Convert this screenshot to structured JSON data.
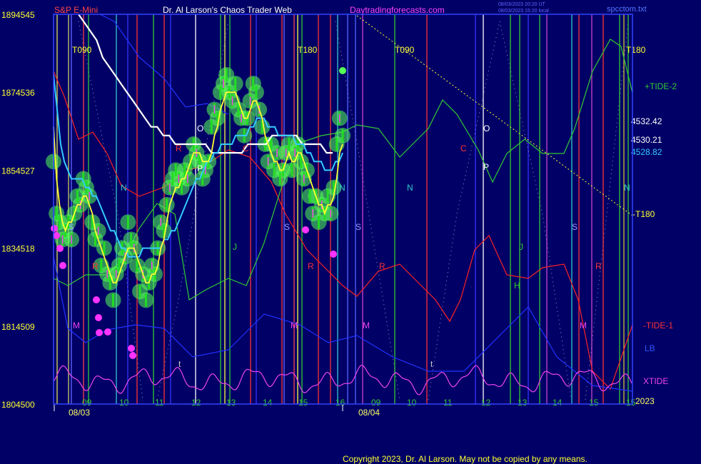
{
  "header": {
    "left_title": "S&P E-Mini",
    "center_title": "Dr. Al Larson's Chaos Trader Web",
    "site": "Daytradingforecasts.com",
    "timestamp_1": "08/03/2023 20:20 UT",
    "timestamp_2": "08/03/2023 15:20 local",
    "file_name": "spcctom.txt"
  },
  "footer": {
    "copyright": "Copyright 2023, Dr. Al Larson. May not be copied by any means."
  },
  "colors": {
    "background": "#000066",
    "price_bars": "#22dd22",
    "glow": "#55ff55",
    "yellow_avg": "#ffff33",
    "cyan_avg": "#33ccff",
    "white_avg": "#ffffff",
    "magenta": "#ff33ff",
    "tide2": "#33cc33",
    "tide1": "#ff2222",
    "lb": "#2233ff",
    "xtide": "#ee44ee"
  },
  "chart_data": {
    "type": "line",
    "title": "S&P E-Mini",
    "y_ticks": [
      {
        "left": "189",
        "right": "4545",
        "value": 4545
      },
      {
        "left": "187",
        "right": "4536",
        "value": 4536
      },
      {
        "left": "185",
        "right": "4527",
        "value": 4527
      },
      {
        "left": "183",
        "right": "4518",
        "value": 4518
      },
      {
        "left": "181",
        "right": "4509",
        "value": 4509
      },
      {
        "left": "180",
        "right": "4500",
        "value": 4500
      }
    ],
    "ylim": [
      4500,
      4545
    ],
    "x_hour_labels": [
      "09",
      "10",
      "11",
      "12",
      "13",
      "14",
      "15",
      "16",
      "09",
      "10",
      "11",
      "12",
      "13",
      "14",
      "15",
      "15"
    ],
    "x_dates": [
      "08/03",
      "08/04"
    ],
    "year_label": "2023",
    "top_labels": [
      "T090",
      "T180",
      "T090",
      "T180"
    ],
    "line_letters": [
      "O",
      "P",
      "O",
      "P",
      "N",
      "N",
      "N",
      "N",
      "S",
      "S",
      "S",
      "S",
      "J",
      "J",
      "H",
      "R",
      "R",
      "R",
      "R",
      "R",
      "C",
      "C",
      "M",
      "M",
      "M",
      "M",
      "t",
      "t"
    ],
    "right_labels": {
      "tide2": "+TIDE-2",
      "price_1": "4532.42",
      "price_2": "4530.21",
      "price_3": "4528.82",
      "t180": "-T180",
      "tide1": "-TIDE-1",
      "lb": "LB",
      "xtide": "XTIDE"
    },
    "price": [
      4528,
      4522,
      4521,
      4519,
      4520,
      4521,
      4519,
      4522,
      4524,
      4523,
      4526,
      4525,
      4524,
      4521,
      4519,
      4520,
      4516,
      4518,
      4515,
      4514,
      4512,
      4515,
      4516,
      4518,
      4517,
      4521,
      4519,
      4518,
      4516,
      4513,
      4515,
      4512,
      4514,
      4516,
      4515,
      4518,
      4521,
      4520,
      4523,
      4525,
      4526,
      4527,
      4526,
      4525,
      4527,
      4526,
      4528,
      4530,
      4529,
      4528,
      4526,
      4527,
      4528,
      4532,
      4534,
      4533,
      4536,
      4537,
      4538,
      4536,
      4535,
      4537,
      4534,
      4533,
      4531,
      4533,
      4535,
      4537,
      4536,
      4534,
      4532,
      4530,
      4528,
      4530,
      4527,
      4529,
      4526,
      4527,
      4529,
      4530,
      4527,
      4529,
      4530,
      4528,
      4526,
      4527,
      4524,
      4522,
      4524,
      4521,
      4523,
      4522,
      4524,
      4522,
      4525,
      4530,
      4533,
      4531
    ],
    "yellow_avg": [
      4532,
      4526,
      4523,
      4521,
      4520,
      4521,
      4521,
      4522,
      4523,
      4523,
      4524,
      4524,
      4523,
      4522,
      4520,
      4519,
      4518,
      4517,
      4516,
      4515,
      4514,
      4514,
      4515,
      4516,
      4517,
      4518,
      4518,
      4518,
      4517,
      4516,
      4515,
      4514,
      4514,
      4515,
      4515,
      4516,
      4518,
      4519,
      4521,
      4523,
      4524,
      4525,
      4525,
      4526,
      4526,
      4527,
      4528,
      4529,
      4529,
      4529,
      4528,
      4528,
      4528,
      4529,
      4531,
      4532,
      4534,
      4535,
      4536,
      4536,
      4536,
      4536,
      4535,
      4534,
      4533,
      4533,
      4534,
      4535,
      4535,
      4534,
      4533,
      4531,
      4530,
      4529,
      4528,
      4528,
      4527,
      4527,
      4528,
      4529,
      4528,
      4528,
      4529,
      4529,
      4528,
      4527,
      4526,
      4525,
      4524,
      4523,
      4523,
      4522,
      4523,
      4523,
      4524,
      4526,
      4529,
      4530
    ],
    "cyan_avg": [
      4538,
      4534,
      4530,
      4528,
      4527,
      4526,
      4526,
      4526,
      4526,
      4525,
      4525,
      4524,
      4524,
      4523,
      4522,
      4521,
      4520,
      4520,
      4519,
      4518,
      4518,
      4517,
      4517,
      4517,
      4517,
      4518,
      4518,
      4518,
      4518,
      4518,
      4518,
      4519,
      4519,
      4520,
      4520,
      4521,
      4522,
      4523,
      4524,
      4525,
      4526,
      4526,
      4527,
      4528,
      4528,
      4529,
      4529,
      4530,
      4530,
      4530,
      4530,
      4531,
      4531,
      4531,
      4531,
      4532,
      4532,
      4533,
      4533,
      4533,
      4532,
      4532,
      4532,
      4531,
      4531,
      4531,
      4531,
      4531,
      4530,
      4530,
      4530,
      4529,
      4529,
      4528,
      4528,
      4528,
      4527,
      4527,
      4527,
      4528,
      4528,
      4529
    ],
    "white_avg": [
      4545,
      4544,
      4543,
      4542,
      4540,
      4539,
      4538,
      4537,
      4536,
      4535,
      4534,
      4533,
      4532,
      4532,
      4531,
      4531,
      4530,
      4530,
      4530,
      4530,
      4530,
      4530,
      4529,
      4529,
      4529,
      4529,
      4529,
      4529,
      4530,
      4530,
      4530,
      4530,
      4531,
      4531,
      4531,
      4531,
      4531,
      4530,
      4530,
      4530,
      4530,
      4529,
      4529
    ]
  }
}
